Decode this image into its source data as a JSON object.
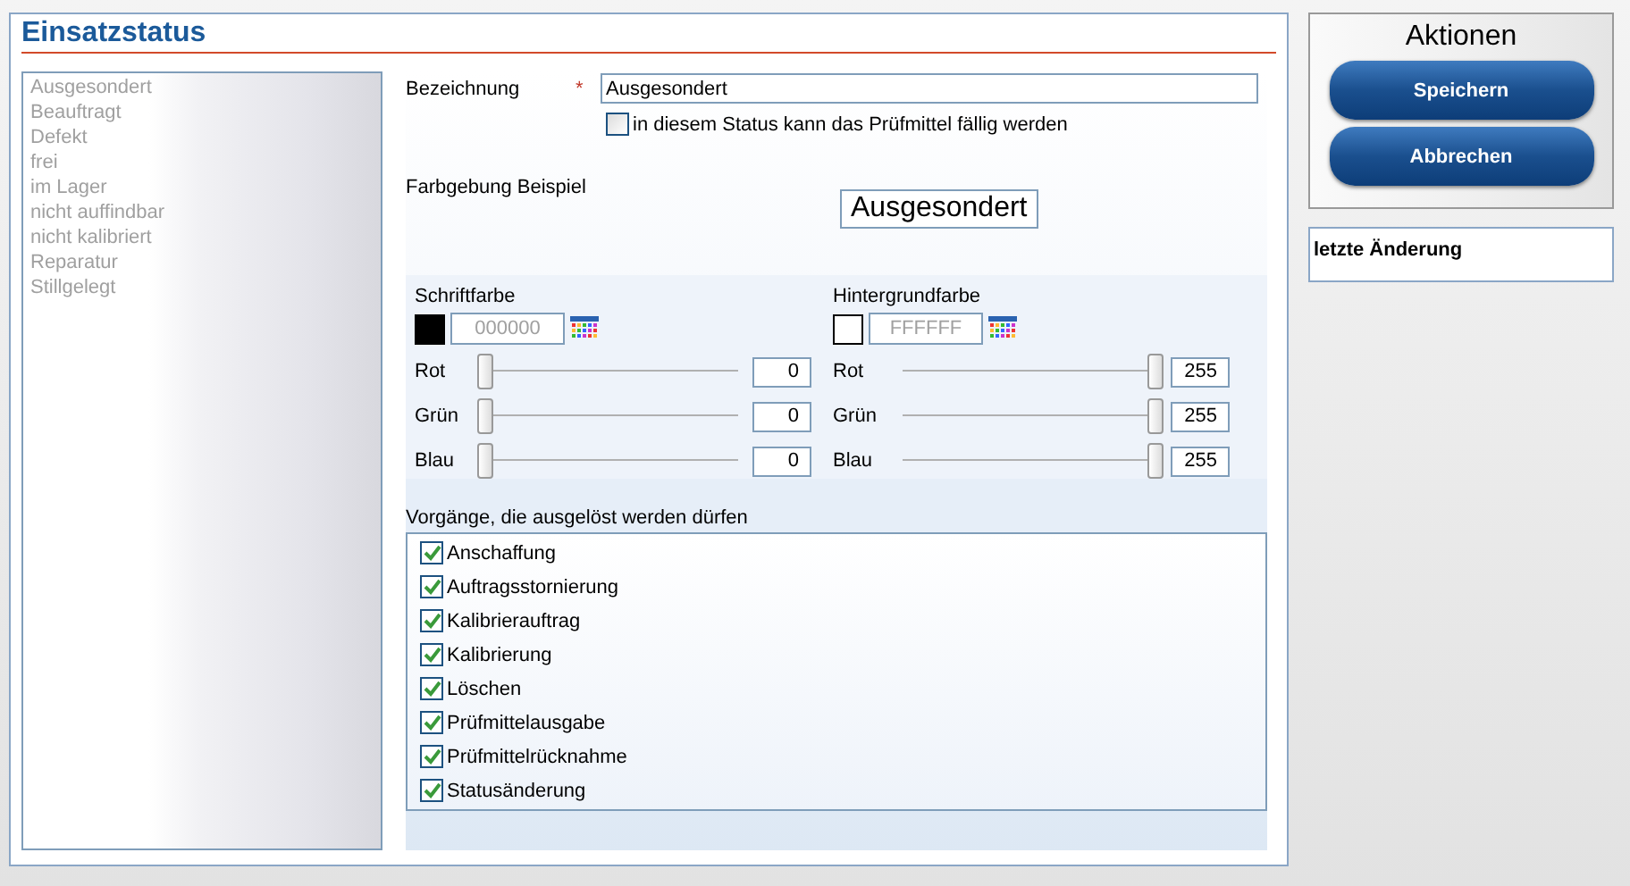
{
  "title": "Einsatzstatus",
  "status_list": [
    {
      "label": "Ausgesondert",
      "selected": false
    },
    {
      "label": "Beauftragt",
      "selected": false
    },
    {
      "label": "Defekt",
      "selected": false
    },
    {
      "label": "frei",
      "selected": false
    },
    {
      "label": "im Lager",
      "selected": false
    },
    {
      "label": "nicht auffindbar",
      "selected": false
    },
    {
      "label": "nicht kalibriert",
      "selected": false
    },
    {
      "label": "Reparatur",
      "selected": false
    },
    {
      "label": "Stillgelegt",
      "selected": false
    }
  ],
  "name_field": {
    "label": "Bezeichnung",
    "required_mark": "*",
    "value": "Ausgesondert"
  },
  "due_checkbox": {
    "label": "in diesem Status kann das Prüfmittel fällig werden",
    "checked": false
  },
  "preview": {
    "label": "Farbgebung Beispiel",
    "text": "Ausgesondert"
  },
  "color_pickers": [
    {
      "label": "Schriftfarbe",
      "hex": "000000",
      "color": "#000000",
      "channels": [
        {
          "label": "Rot",
          "level": 0,
          "value": "0"
        },
        {
          "label": "Grün",
          "level": 0,
          "value": "0"
        },
        {
          "label": "Blau",
          "level": 0,
          "value": "0"
        }
      ]
    },
    {
      "label": "Hintergrundfarbe",
      "hex": "FFFFFF",
      "color": "#ffffff",
      "channels": [
        {
          "label": "Rot",
          "level": 1,
          "value": "255"
        },
        {
          "label": "Grün",
          "level": 1,
          "value": "255"
        },
        {
          "label": "Blau",
          "level": 1,
          "value": "255"
        }
      ]
    }
  ],
  "processes": {
    "label": "Vorgänge, die ausgelöst werden dürfen",
    "items": [
      {
        "label": "Anschaffung",
        "checked": true
      },
      {
        "label": "Auftragsstornierung",
        "checked": true
      },
      {
        "label": "Kalibrierauftrag",
        "checked": true
      },
      {
        "label": "Kalibrierung",
        "checked": true
      },
      {
        "label": "Löschen",
        "checked": true
      },
      {
        "label": "Prüfmittelausgabe",
        "checked": true
      },
      {
        "label": "Prüfmittelrücknahme",
        "checked": true
      },
      {
        "label": "Statusänderung",
        "checked": true
      }
    ]
  },
  "actions": {
    "title": "Aktionen",
    "buttons": [
      "Speichern",
      "Abbrechen"
    ]
  },
  "last_change": {
    "label": "letzte Änderung"
  }
}
